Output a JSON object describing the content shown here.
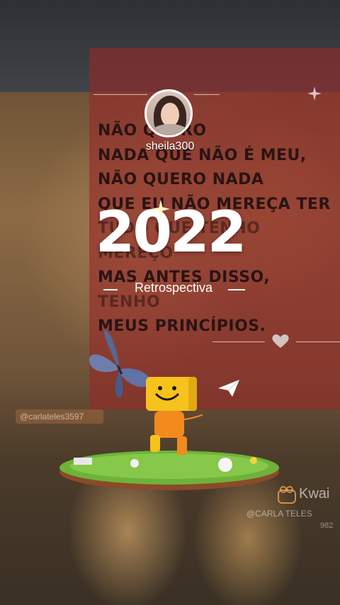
{
  "poem": {
    "lines": [
      "NÃO QUERO",
      "NADA QUE NÃO É MEU,",
      "NÃO QUERO NADA",
      "QUE EU NÃO MEREÇA TER",
      "TUDO QUE TENHO",
      "MEREÇO",
      "MAS ANTES DISSO,",
      "TENHO",
      "MEUS PRINCÍPIOS."
    ]
  },
  "profile": {
    "username": "sheila300"
  },
  "title": {
    "year": "2022",
    "subtitle": "Retrospectiva"
  },
  "watermarks": {
    "left_handle": "@carlateles3597",
    "brand": "Kwai",
    "brand_user": "@CARLA TELES",
    "brand_id": "982"
  },
  "icons": {
    "sparkle": "sparkle-icon",
    "heart": "heart-icon",
    "butterfly": "butterfly-icon",
    "paper_plane": "paper-plane-icon",
    "mascot": "smiley-box-mascot",
    "kwai_logo": "kwai-logo-icon"
  },
  "colors": {
    "panel": "#962828",
    "poem_text": "#2a1414",
    "title": "#ffffff",
    "mascot_head": "#f6c21c",
    "mascot_body": "#f28a1e",
    "grass": "#6fb23a"
  }
}
